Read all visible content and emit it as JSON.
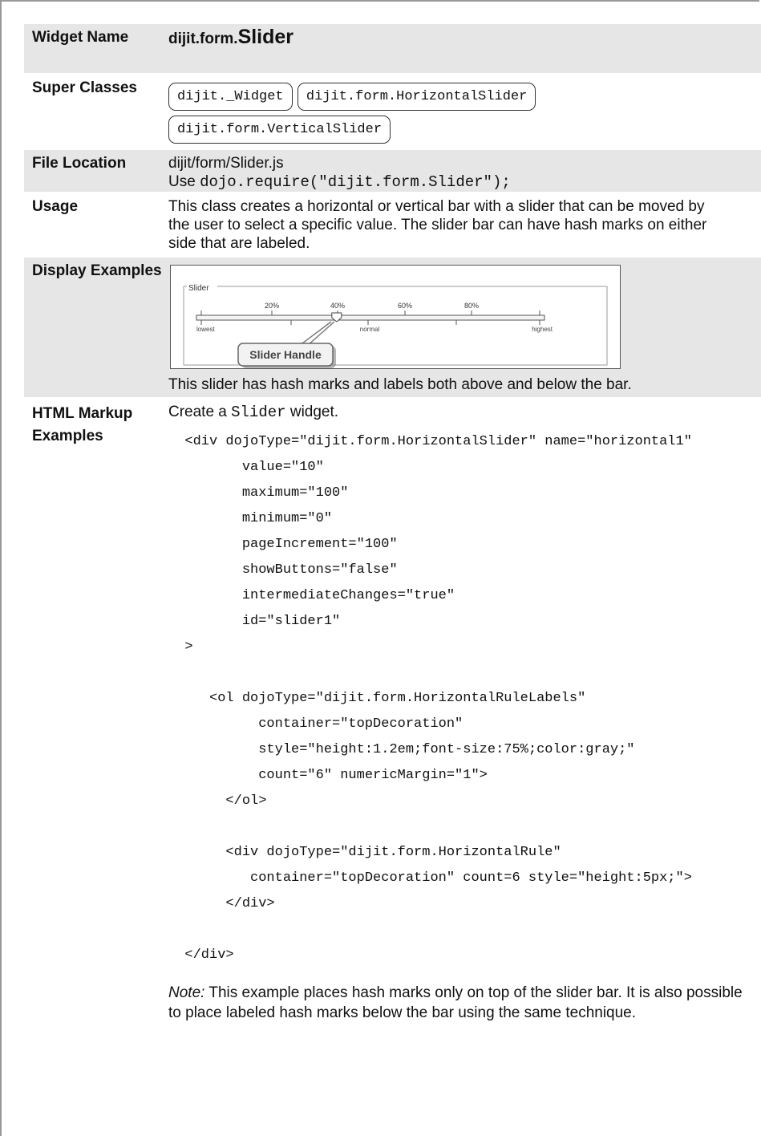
{
  "widget_name": {
    "label": "Widget Name",
    "value_prefix": "dijit.form.",
    "value_main": "Slider"
  },
  "super_classes": {
    "label": "Super Classes",
    "items": [
      "dijit._Widget",
      "dijit.form.HorizontalSlider",
      "dijit.form.VerticalSlider"
    ]
  },
  "file_location": {
    "label": "File Location",
    "path": "dijit/form/Slider.js",
    "use_prefix": "Use",
    "use_code": "dojo.require(\"dijit.form.Slider\");"
  },
  "usage": {
    "label": "Usage",
    "text": "This class creates a horizontal or vertical bar with a slider that can be moved by the user to select a specific value. The slider bar can have hash marks on either side that are labeled."
  },
  "display_examples": {
    "label": "Display Examples",
    "fieldset_legend": "Slider",
    "top_labels": [
      "20%",
      "40%",
      "60%",
      "80%"
    ],
    "bottom_labels": [
      "lowest",
      "normal",
      "highest"
    ],
    "callout": "Slider Handle",
    "slider_value": 0.4,
    "caption": "This slider has hash marks and labels both above and below the bar."
  },
  "html_markup": {
    "label": "HTML Markup Examples",
    "intro_prefix": "Create a",
    "intro_code": "Slider",
    "intro_suffix": "widget.",
    "code": "  <div dojoType=\"dijit.form.HorizontalSlider\" name=\"horizontal1\"\n         value=\"10\"\n         maximum=\"100\"\n         minimum=\"0\"\n         pageIncrement=\"100\"\n         showButtons=\"false\"\n         intermediateChanges=\"true\"\n         id=\"slider1\"\n  >\n\n     <ol dojoType=\"dijit.form.HorizontalRuleLabels\"\n           container=\"topDecoration\"\n           style=\"height:1.2em;font-size:75%;color:gray;\"\n           count=\"6\" numericMargin=\"1\">\n       </ol>\n\n       <div dojoType=\"dijit.form.HorizontalRule\"\n          container=\"topDecoration\" count=6 style=\"height:5px;\">\n       </div>\n\n  </div>",
    "note_label": "Note:",
    "note_text": " This example places hash marks only on top of the slider bar. It is also possible to place labeled hash marks below the bar using the same technique."
  }
}
